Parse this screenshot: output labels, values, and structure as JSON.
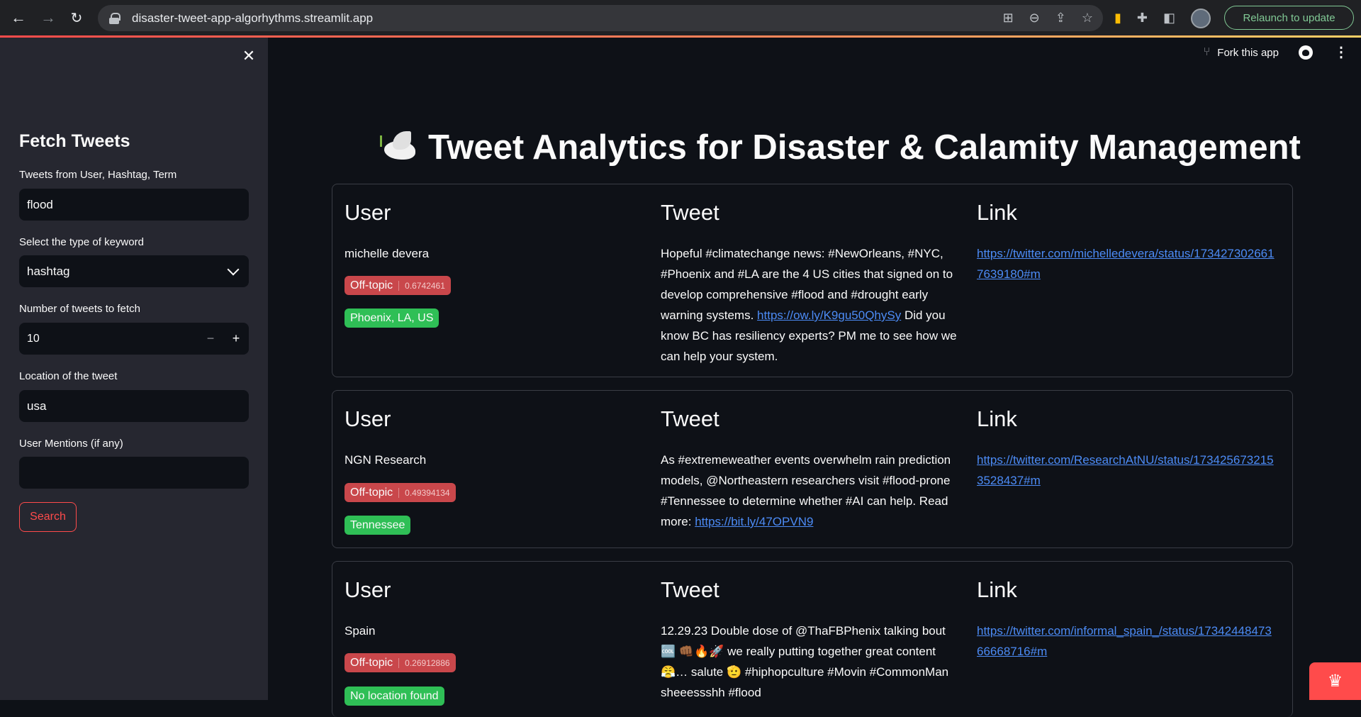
{
  "browser": {
    "url": "disaster-tweet-app-algorhythms.streamlit.app",
    "relaunch_label": "Relaunch to update"
  },
  "sidebar": {
    "title": "Fetch Tweets",
    "fields": {
      "term_label": "Tweets from User, Hashtag, Term",
      "term_value": "flood",
      "keyword_type_label": "Select the type of keyword",
      "keyword_type_value": "hashtag",
      "count_label": "Number of tweets to fetch",
      "count_value": "10",
      "location_label": "Location of the tweet",
      "location_value": "usa",
      "mentions_label": "User Mentions (if any)",
      "mentions_value": ""
    },
    "search_label": "Search"
  },
  "toolbar": {
    "fork_label": "Fork this app"
  },
  "main": {
    "title": "Tweet Analytics for Disaster & Calamity Management",
    "headers": {
      "user": "User",
      "tweet": "Tweet",
      "link": "Link"
    },
    "tweets": [
      {
        "user": "michelle devera",
        "topic": "Off-topic",
        "score": "0.6742461",
        "location": "Phoenix, LA, US",
        "text_before": "Hopeful #climatechange news: #NewOrleans, #NYC, #Phoenix and #LA are the 4 US cities that signed on to develop comprehensive #flood and #drought early warning systems. ",
        "inline_link": "https://ow.ly/K9gu50QhySy",
        "text_after": " Did you know BC has resiliency experts? PM me to see how we can help your system.",
        "link": "https://twitter.com/michelledevera/status/1734273026617639180#m"
      },
      {
        "user": "NGN Research",
        "topic": "Off-topic",
        "score": "0.49394134",
        "location": "Tennessee",
        "text_before": "As #extremeweather events overwhelm rain prediction models, @Northeastern researchers visit #flood-prone #Tennessee to determine whether #AI can help. Read more: ",
        "inline_link": "https://bit.ly/47OPVN9",
        "text_after": "",
        "link": "https://twitter.com/ResearchAtNU/status/1734256732153528437#m"
      },
      {
        "user": "Spain",
        "topic": "Off-topic",
        "score": "0.26912886",
        "location": "No location found",
        "text_before": "12.29.23 Double dose of @ThaFBPhenix talking bout 🆒 👊🏾🔥🚀 we really putting together great content 😤… salute 🫡 #hiphopculture #Movin #CommonMan sheeessshh #flood",
        "inline_link": "",
        "text_after": "",
        "link": "https://twitter.com/informal_spain_/status/1734244847366668716#m"
      }
    ]
  },
  "colors": {
    "accent": "#ff4b4b",
    "link": "#4c8bf5",
    "badge_green": "#2fbf56",
    "badge_red": "#c9474b"
  }
}
